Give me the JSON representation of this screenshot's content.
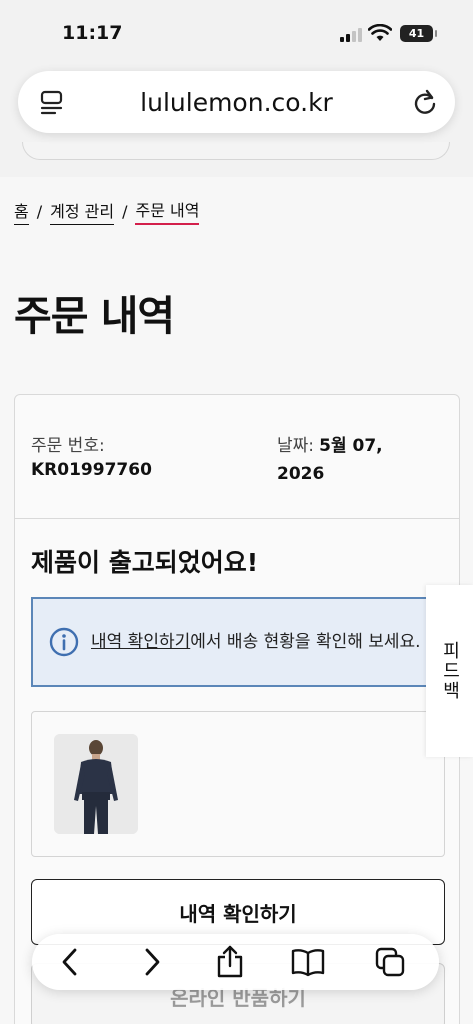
{
  "status_bar": {
    "time": "11:17",
    "battery": "41"
  },
  "browser": {
    "url": "lululemon.co.kr"
  },
  "breadcrumb": {
    "home": "홈",
    "account": "계정 관리",
    "current": "주문 내역",
    "separator": "/"
  },
  "page": {
    "title": "주문 내역"
  },
  "order": {
    "number_label": "주문 번호:",
    "number_value": "KR01997760",
    "date_label": "날짜:",
    "date_value": "5월 07, 2026"
  },
  "shipment": {
    "title": "제품이 출고되었어요!",
    "info_link": "내역 확인하기",
    "info_text": "에서 배송 현황을 확인해 보세요."
  },
  "buttons": {
    "view_history": "내역 확인하기",
    "online_return": "온라인 반품하기"
  },
  "side_tab": {
    "label": "피드백"
  },
  "icons": {
    "reader": "reader-icon",
    "reload": "reload-icon",
    "info": "info-icon",
    "back": "back-icon",
    "forward": "forward-icon",
    "share": "share-icon",
    "bookmarks": "book-icon",
    "tabs": "tabs-icon"
  },
  "colors": {
    "accent_red": "#d31f4b",
    "info_border": "#5b86b8",
    "info_bg": "#e6edf7"
  }
}
